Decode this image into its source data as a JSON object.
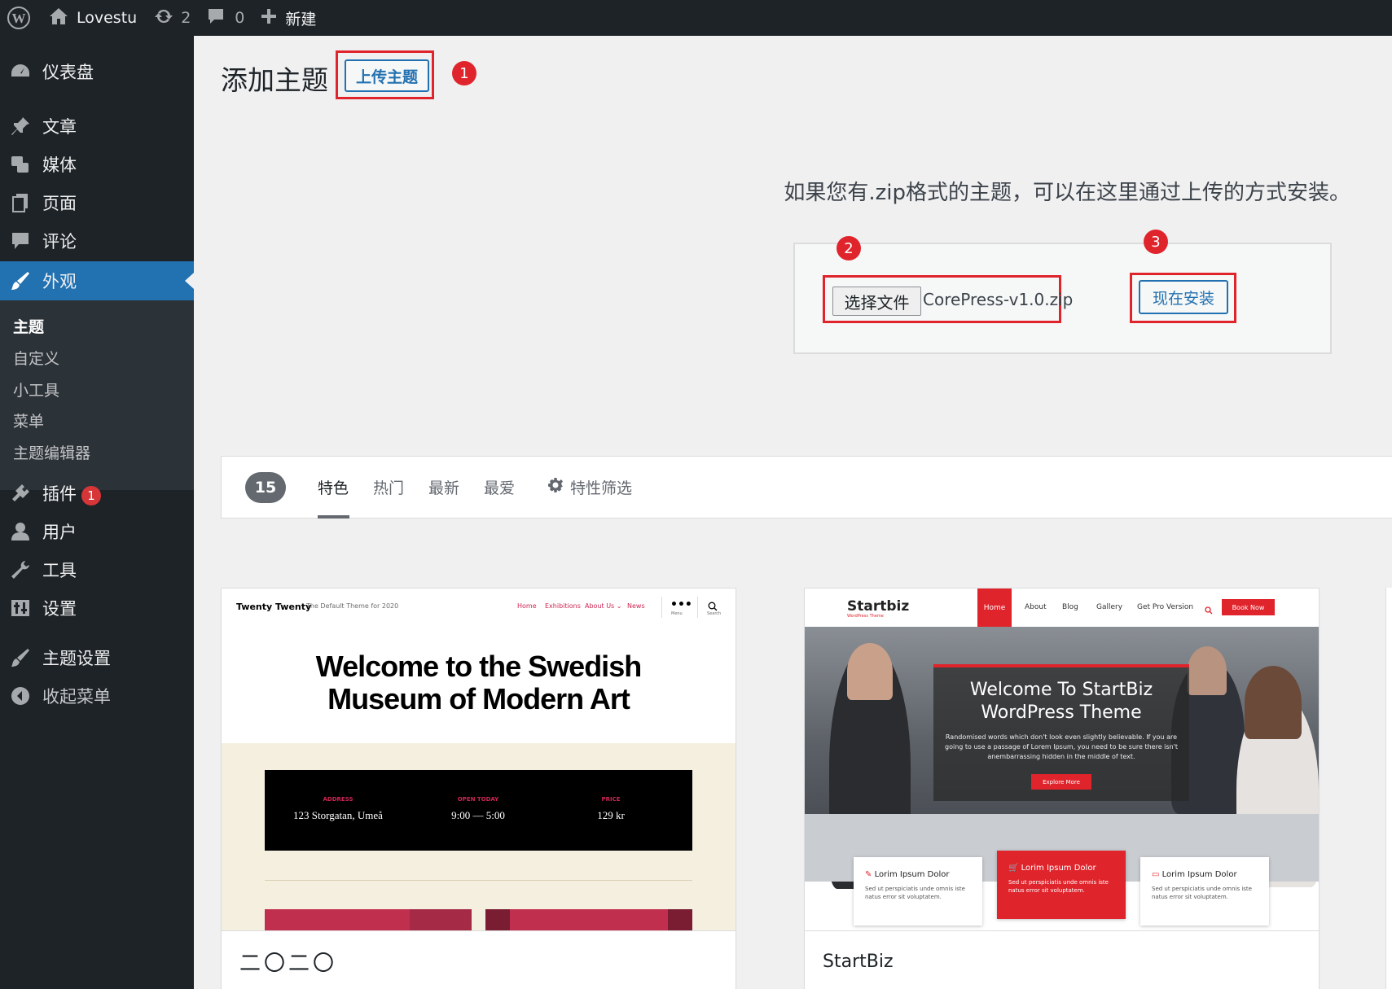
{
  "adminbar": {
    "site_name": "Lovestu",
    "updates_count": "2",
    "comments_count": "0",
    "new_label": "新建"
  },
  "sidebar": {
    "items": [
      {
        "label": "仪表盘",
        "icon": "dashboard-icon"
      },
      {
        "label": "文章",
        "icon": "pin-icon"
      },
      {
        "label": "媒体",
        "icon": "media-icon"
      },
      {
        "label": "页面",
        "icon": "page-icon"
      },
      {
        "label": "评论",
        "icon": "comment-icon"
      },
      {
        "label": "外观",
        "icon": "brush-icon"
      },
      {
        "label": "插件",
        "icon": "plugin-icon",
        "badge": "1"
      },
      {
        "label": "用户",
        "icon": "user-icon"
      },
      {
        "label": "工具",
        "icon": "wrench-icon"
      },
      {
        "label": "设置",
        "icon": "settings-icon"
      },
      {
        "label": "主题设置",
        "icon": "brush-icon"
      },
      {
        "label": "收起菜单",
        "icon": "collapse-icon"
      }
    ],
    "submenu": [
      "主题",
      "自定义",
      "小工具",
      "菜单",
      "主题编辑器"
    ]
  },
  "main": {
    "title": "添加主题",
    "upload_button": "上传主题",
    "upload_description": "如果您有.zip格式的主题，可以在这里通过上传的方式安装。",
    "choose_file_button": "选择文件",
    "file_name": "CorePress-v1.0.zip",
    "install_button": "现在安装",
    "markers": [
      "1",
      "2",
      "3"
    ]
  },
  "filter": {
    "count": "15",
    "tabs": [
      "特色",
      "热门",
      "最新",
      "最爱"
    ],
    "active_tab": "特色",
    "feature_filter": "特性筛选"
  },
  "themes": [
    {
      "name": "二〇二〇",
      "preview": {
        "brand": "Twenty Twenty",
        "tagline": "The Default Theme for 2020",
        "nav": [
          "Home",
          "Exhibitions",
          "About Us ⌄",
          "News"
        ],
        "menu_label": "Menu",
        "search_label": "Search",
        "hero": "Welcome to the Swedish Museum of Modern Art",
        "info": [
          {
            "key": "ADDRESS",
            "value": "123 Storgatan, Umeå"
          },
          {
            "key": "OPEN TODAY",
            "value": "9:00 — 5:00"
          },
          {
            "key": "PRICE",
            "value": "129 kr"
          }
        ]
      }
    },
    {
      "name": "StartBiz",
      "preview": {
        "logo": "Startbiz",
        "logo_sub": "WordPress Theme",
        "nav": [
          "Home",
          "About",
          "Blog",
          "Gallery",
          "Get Pro Version"
        ],
        "book_button": "Book Now",
        "hero_title": "Welcome To StartBiz WordPress Theme",
        "hero_text": "Randomised words which don't look even slightly believable. If you are going to use a passage of Lorem Ipsum, you need to be sure there isn't anembarrassing hidden in the middle of text.",
        "explore_button": "Explore More",
        "boxes": [
          {
            "title": "Lorim Ipsum Dolor",
            "text": "Sed ut perspiciatis unde omnis iste natus error sit voluptatem."
          },
          {
            "title": "Lorim Ipsum Dolor",
            "text": "Sed ut perspiciatis unde omnis iste natus error sit voluptatem."
          },
          {
            "title": "Lorim Ipsum Dolor",
            "text": "Sed ut perspiciatis unde omnis iste natus error sit voluptatem."
          }
        ]
      }
    }
  ],
  "colors": {
    "admin_dark": "#1d2327",
    "accent_blue": "#2271b1",
    "highlight_red": "#e0242c"
  }
}
